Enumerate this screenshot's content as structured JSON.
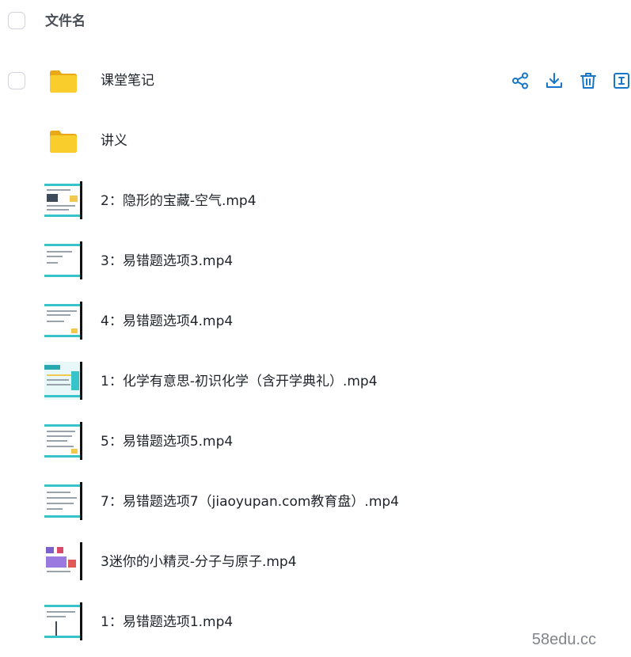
{
  "header": {
    "column_label": "文件名"
  },
  "files": [
    {
      "name": "课堂笔记",
      "type": "folder"
    },
    {
      "name": "讲义",
      "type": "folder"
    },
    {
      "name": "2：隐形的宝藏-空气.mp4",
      "type": "video"
    },
    {
      "name": "3：易错题选项3.mp4",
      "type": "video"
    },
    {
      "name": "4：易错题选项4.mp4",
      "type": "video"
    },
    {
      "name": "1：化学有意思-初识化学（含开学典礼）.mp4",
      "type": "video"
    },
    {
      "name": "5：易错题选项5.mp4",
      "type": "video"
    },
    {
      "name": "7：易错题选项7（jiaoyupan.com教育盘）.mp4",
      "type": "video"
    },
    {
      "name": "3迷你的小精灵-分子与原子.mp4",
      "type": "video"
    },
    {
      "name": "1：易错题选项1.mp4",
      "type": "video"
    }
  ],
  "row_actions": {
    "icons": [
      "share-icon",
      "download-icon",
      "delete-icon",
      "rename-icon"
    ]
  },
  "colors": {
    "action_blue": "#1677c8",
    "folder_yellow": "#f5c518"
  },
  "watermark": "58edu.cc"
}
